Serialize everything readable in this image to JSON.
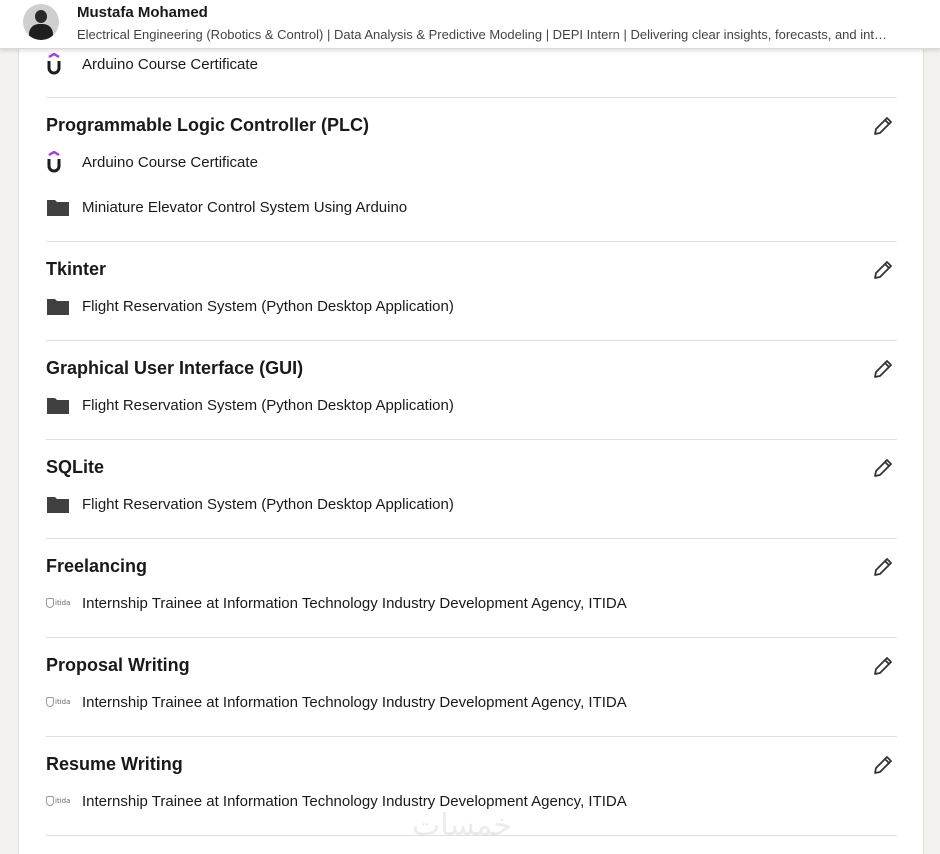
{
  "header": {
    "name": "Mustafa Mohamed",
    "headline": "Electrical Engineering (Robotics & Control) | Data Analysis & Predictive Modeling | DEPI Intern | Delivering clear insights, forecasts, and int…"
  },
  "top_entry": {
    "icon": "udemy-icon",
    "text": "Arduino Course Certificate"
  },
  "skills": [
    {
      "title": "Programmable Logic Controller (PLC)",
      "entries": [
        {
          "icon": "udemy-icon",
          "text": "Arduino Course Certificate"
        },
        {
          "icon": "folder-icon",
          "text": "Miniature Elevator Control System Using Arduino"
        }
      ]
    },
    {
      "title": "Tkinter",
      "entries": [
        {
          "icon": "folder-icon",
          "text": "Flight Reservation System (Python Desktop Application)"
        }
      ]
    },
    {
      "title": "Graphical User Interface (GUI)",
      "entries": [
        {
          "icon": "folder-icon",
          "text": "Flight Reservation System (Python Desktop Application)"
        }
      ]
    },
    {
      "title": "SQLite",
      "entries": [
        {
          "icon": "folder-icon",
          "text": "Flight Reservation System (Python Desktop Application)"
        }
      ]
    },
    {
      "title": "Freelancing",
      "entries": [
        {
          "icon": "itida-logo",
          "text": "Internship Trainee at Information Technology Industry Development Agency, ITIDA"
        }
      ]
    },
    {
      "title": "Proposal Writing",
      "entries": [
        {
          "icon": "itida-logo",
          "text": "Internship Trainee at Information Technology Industry Development Agency, ITIDA"
        }
      ]
    },
    {
      "title": "Resume Writing",
      "entries": [
        {
          "icon": "itida-logo",
          "text": "Internship Trainee at Information Technology Industry Development Agency, ITIDA"
        }
      ]
    }
  ],
  "watermark": "خمسات",
  "logo_text": {
    "itida": "itida"
  },
  "colors": {
    "udemy_purple": "#a435f0",
    "icon_dark": "#404040",
    "divider": "#e0e0e0"
  }
}
